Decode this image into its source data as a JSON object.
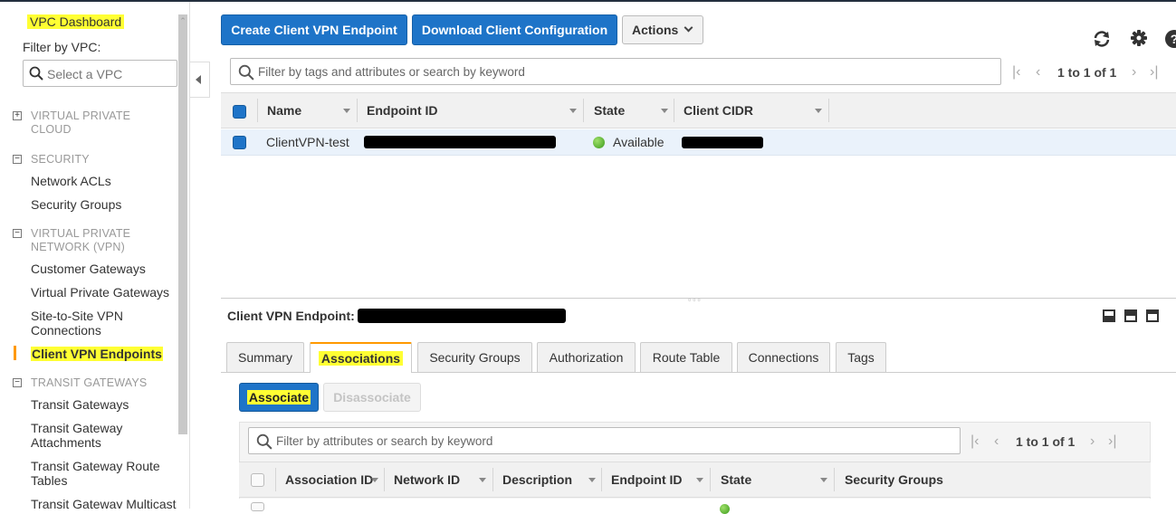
{
  "sidebar": {
    "dashboard_label": "VPC Dashboard",
    "filter_label": "Filter by VPC:",
    "select_placeholder": "Select a VPC",
    "sections": {
      "vpc": {
        "line1": "VIRTUAL PRIVATE",
        "line2": "CLOUD",
        "toggle": "+"
      },
      "security": {
        "line1": "SECURITY",
        "toggle": "−"
      },
      "vpn": {
        "line1": "VIRTUAL PRIVATE",
        "line2": "NETWORK (VPN)",
        "toggle": "−"
      },
      "tgw": {
        "line1": "TRANSIT GATEWAYS",
        "toggle": "−"
      }
    },
    "items": {
      "network_acls": "Network ACLs",
      "security_groups": "Security Groups",
      "customer_gateways": "Customer Gateways",
      "virtual_private_gateways": "Virtual Private Gateways",
      "s2s_line1": "Site-to-Site VPN",
      "s2s_line2": "Connections",
      "client_vpn": "Client VPN Endpoints",
      "transit_gateways": "Transit Gateways",
      "tga_line1": "Transit Gateway",
      "tga_line2": "Attachments",
      "tgrt_line1": "Transit Gateway Route",
      "tgrt_line2": "Tables",
      "tgm_line1": "Transit Gateway Multicast"
    }
  },
  "toolbar": {
    "create_label": "Create Client VPN Endpoint",
    "download_label": "Download Client Configuration",
    "actions_label": "Actions",
    "refresh_icon": "refresh-icon",
    "settings_icon": "gear-icon",
    "help_icon": "help-icon"
  },
  "search": {
    "placeholder": "Filter by tags and attributes or search by keyword",
    "pager": "1 to 1 of 1"
  },
  "table": {
    "columns": [
      "Name",
      "Endpoint ID",
      "State",
      "Client CIDR"
    ],
    "rows": [
      {
        "name": "ClientVPN-test",
        "endpoint_id": "[redacted]",
        "state": "Available",
        "client_cidr": "[redacted]"
      }
    ]
  },
  "detail": {
    "title": "Client VPN Endpoint:",
    "tabs": [
      "Summary",
      "Associations",
      "Security Groups",
      "Authorization",
      "Route Table",
      "Connections",
      "Tags"
    ],
    "active_tab": "Associations",
    "associate_label": "Associate",
    "disassociate_label": "Disassociate",
    "search_placeholder": "Filter by attributes or search by keyword",
    "pager": "1 to 1 of 1",
    "columns": [
      "Association ID",
      "Network ID",
      "Description",
      "Endpoint ID",
      "State",
      "Security Groups"
    ]
  },
  "colors": {
    "primary_button": "#1e74c8",
    "highlight": "#ffff33",
    "active_indicator": "#ff9900",
    "status_available": "#3a9a1a"
  }
}
